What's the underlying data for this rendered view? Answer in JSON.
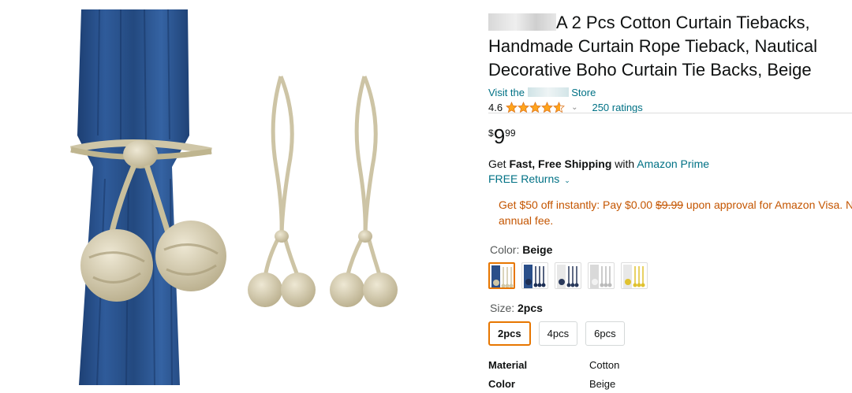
{
  "product": {
    "title_brand_obscured": "",
    "title_rest": "A 2 Pcs Cotton Curtain Tiebacks, Handmade Curtain Rope Tieback, Nautical Decorative Boho Curtain Tie Backs, Beige",
    "store_link_prefix": "Visit the ",
    "store_link_suffix": " Store",
    "rating_value": "4.6",
    "rating_stars": 4.6,
    "ratings_count": "250 ratings"
  },
  "price": {
    "symbol": "$",
    "whole": "9",
    "fraction": "99"
  },
  "shipping": {
    "prefix": "Get ",
    "bold": "Fast, Free Shipping",
    "middle": " with ",
    "link": "Amazon Prime"
  },
  "returns": {
    "label": "FREE Returns"
  },
  "promo": {
    "part1": "Get $50 off instantly: Pay $0.00 ",
    "strike": "$9.99",
    "part2": " upon approval for Amazon Visa. No",
    "line2": "annual fee."
  },
  "color": {
    "label": "Color: ",
    "value": "Beige",
    "swatches": [
      "beige",
      "navy",
      "white-navy",
      "white",
      "yellow"
    ]
  },
  "size": {
    "label": "Size: ",
    "value": "2pcs",
    "options": [
      "2pcs",
      "4pcs",
      "6pcs"
    ]
  },
  "specs": [
    {
      "key": "Material",
      "value": "Cotton"
    },
    {
      "key": "Color",
      "value": "Beige"
    }
  ],
  "colors": {
    "link": "#007185",
    "promo": "#c45500",
    "star": "#ffa41c",
    "selected_border": "#e77600"
  }
}
